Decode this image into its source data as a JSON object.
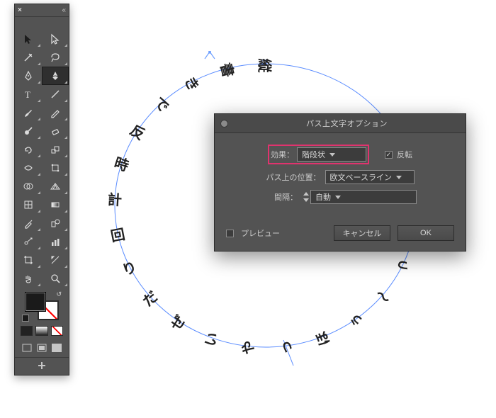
{
  "tools": {
    "header": {
      "close": "×",
      "collapse": "«"
    },
    "names": [
      [
        "selection",
        "direct-selection"
      ],
      [
        "magic-wand",
        "lasso"
      ],
      [
        "pen",
        "curvature"
      ],
      [
        "type",
        "line-segment"
      ],
      [
        "paintbrush",
        "pencil"
      ],
      [
        "blob-brush",
        "eraser"
      ],
      [
        "rotate",
        "scale"
      ],
      [
        "width",
        "free-transform"
      ],
      [
        "shape-builder",
        "perspective-grid"
      ],
      [
        "mesh",
        "gradient"
      ],
      [
        "eyedropper",
        "blend"
      ],
      [
        "symbol-sprayer",
        "column-graph"
      ],
      [
        "artboard",
        "slice"
      ],
      [
        "hand",
        "zoom"
      ]
    ],
    "selected": "curvature",
    "swatches": {
      "mode_icons": [
        "normal",
        "full",
        "presentation"
      ]
    }
  },
  "canvas": {
    "path_text": "縦書きで反時計回りだぜいやっほぅ～っ",
    "path_type": "ellipse"
  },
  "dialog": {
    "title": "パス上文字オプション",
    "rows": {
      "effect_label": "効果：",
      "effect_value": "階段状",
      "flip_label": "反転",
      "flip_checked": true,
      "position_label": "パス上の位置：",
      "position_value": "欧文ベースライン",
      "spacing_label": "間隔：",
      "spacing_value": "自動"
    },
    "footer": {
      "preview_label": "プレビュー",
      "preview_checked": false,
      "cancel": "キャンセル",
      "ok": "OK"
    }
  }
}
